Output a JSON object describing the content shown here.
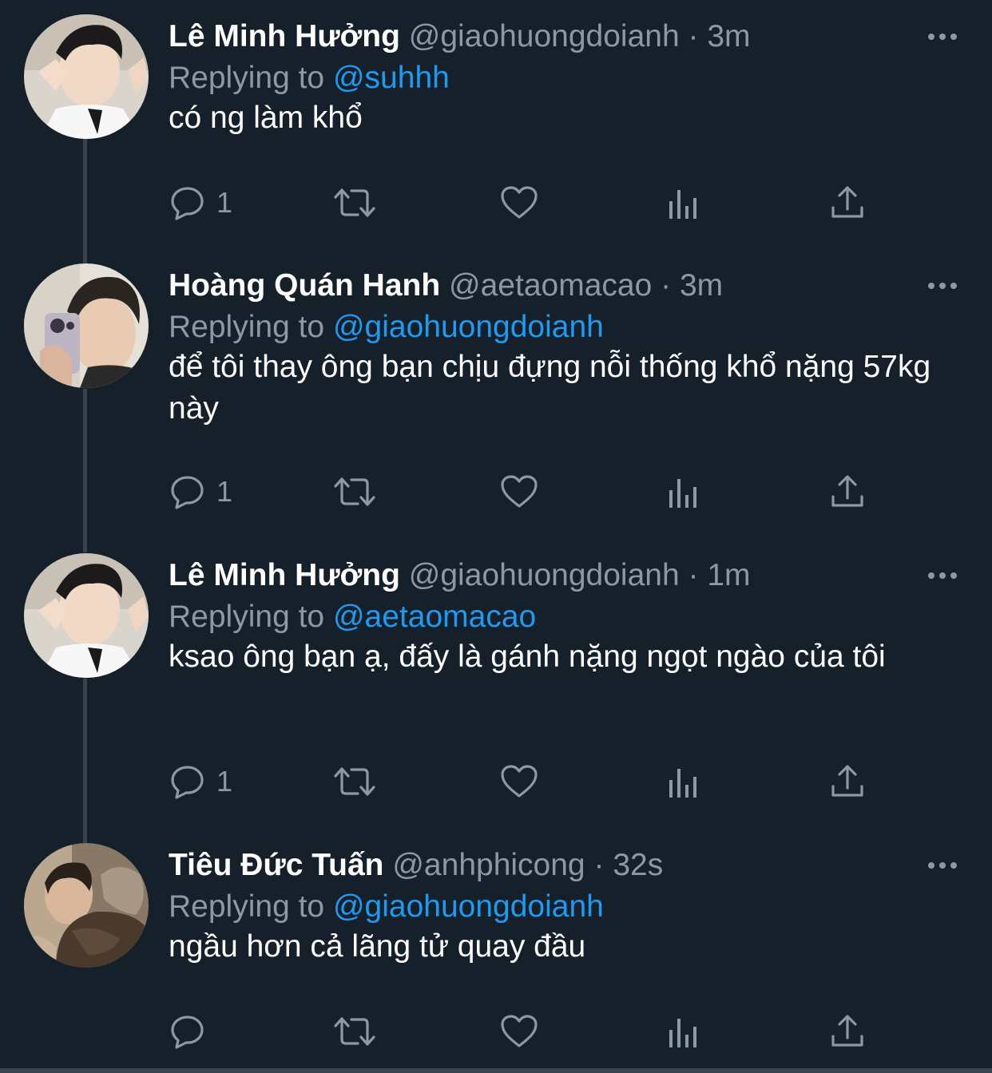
{
  "colors": {
    "background": "#15202b",
    "text_primary": "#ffffff",
    "text_secondary": "#8b98a5",
    "mention": "#1d9bf0",
    "thread_line": "#38444d"
  },
  "tweets": [
    {
      "name": "Lê Minh Hưởng",
      "handle": "@giaohuongdoianh",
      "separator": "·",
      "time": "3m",
      "replying_prefix": "Replying to",
      "replying_to": "@suhhh",
      "text": "có ng làm khổ",
      "reply_count": "1",
      "avatar_icon": "avatar-photo"
    },
    {
      "name": "Hoàng Quán Hanh",
      "handle": "@aetaomacao",
      "separator": "·",
      "time": "3m",
      "replying_prefix": "Replying to",
      "replying_to": "@giaohuongdoianh",
      "text": "để tôi thay ông bạn chịu đựng nỗi thống khổ nặng 57kg này",
      "reply_count": "1",
      "avatar_icon": "avatar-photo"
    },
    {
      "name": "Lê Minh Hưởng",
      "handle": "@giaohuongdoianh",
      "separator": "·",
      "time": "1m",
      "replying_prefix": "Replying to",
      "replying_to": "@aetaomacao",
      "text": "ksao ông bạn ạ, đấy là gánh nặng ngọt ngào của tôi",
      "reply_count": "1",
      "avatar_icon": "avatar-photo"
    },
    {
      "name": "Tiêu Đức Tuấn",
      "handle": "@anhphicong",
      "separator": "·",
      "time": "32s",
      "replying_prefix": "Replying to",
      "replying_to": "@giaohuongdoianh",
      "text": "ngầu hơn cả lãng tử quay đầu",
      "reply_count": "",
      "avatar_icon": "avatar-photo"
    }
  ],
  "action_icons": [
    "reply-icon",
    "retweet-icon",
    "like-icon",
    "views-icon",
    "share-icon"
  ],
  "more_icon": "more-options-icon"
}
